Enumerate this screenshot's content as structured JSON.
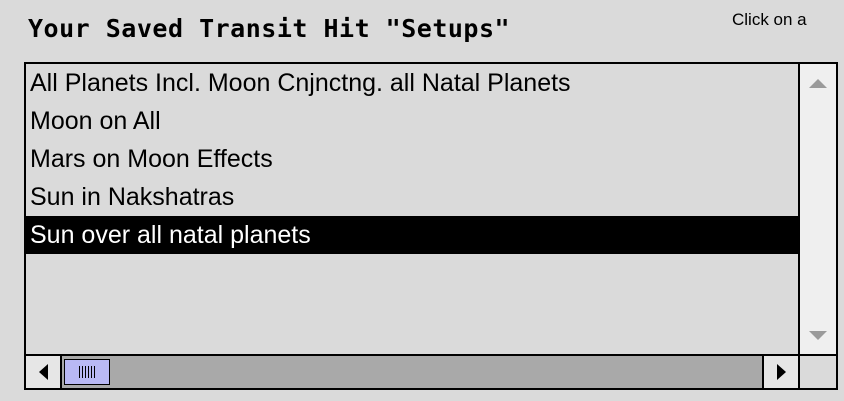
{
  "header": {
    "title": "Your Saved Transit Hit \"Setups\"",
    "hint_text": "Click on a"
  },
  "list": {
    "items": [
      {
        "label": "All Planets Incl. Moon Cnjnctng. all Natal Planets",
        "selected": false
      },
      {
        "label": "Moon on All",
        "selected": false
      },
      {
        "label": "Mars on Moon Effects",
        "selected": false
      },
      {
        "label": "Sun in Nakshatras",
        "selected": false
      },
      {
        "label": "Sun over all natal planets",
        "selected": true
      }
    ]
  },
  "colors": {
    "background": "#dadada",
    "selection": "#000000",
    "scroll_thumb": "#b9b9f4"
  },
  "icons": {
    "scroll_up": "triangle-up-icon",
    "scroll_down": "triangle-down-icon",
    "scroll_left": "triangle-left-icon",
    "scroll_right": "triangle-right-icon",
    "thumb_grip": "grip-icon"
  }
}
